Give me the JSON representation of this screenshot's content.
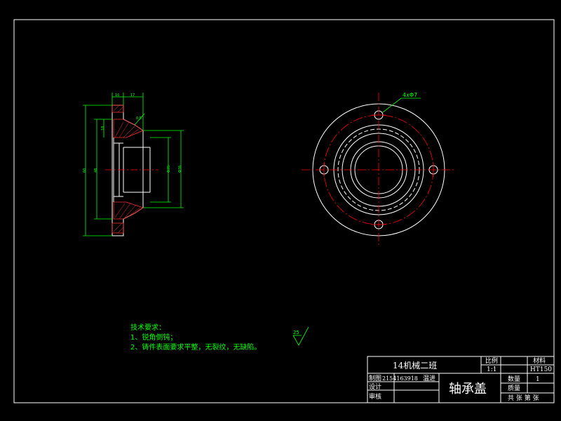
{
  "tech_requirements": {
    "title": "技术要求：",
    "items": [
      "1、锐角倒钝；",
      "2、铸件表面要求平整，无裂纹，无缺陷。"
    ]
  },
  "roughness_symbol_value": "25",
  "hole_callout": "4xΦ7",
  "side_view_dims": {
    "top_width_1": "10",
    "top_width_2": "17",
    "chamfer": "0.5",
    "left_small": "18",
    "left_outer": "60",
    "left_inner": "48",
    "right_bore": "Φ35",
    "right_outer": "Φ36"
  },
  "title_block": {
    "class_name": "14机械二班",
    "scale_label": "比例",
    "scale_value": "1:1",
    "material_label": "材料",
    "material_value": "HT150",
    "draw_label": "制图",
    "student_id": "2154163918",
    "drafter": "温进",
    "design_label": "设计",
    "review_label": "审核",
    "part_name": "轴承盖",
    "qty_label": "数量",
    "qty_value": "1",
    "weight_label": "质量",
    "sheet_info": "共 张 第 张"
  },
  "colors": {
    "background": "#000000",
    "line": "#ffffff",
    "dimension": "#00ff00",
    "centerline": "#ff0000",
    "hatch": "#ff3030"
  }
}
